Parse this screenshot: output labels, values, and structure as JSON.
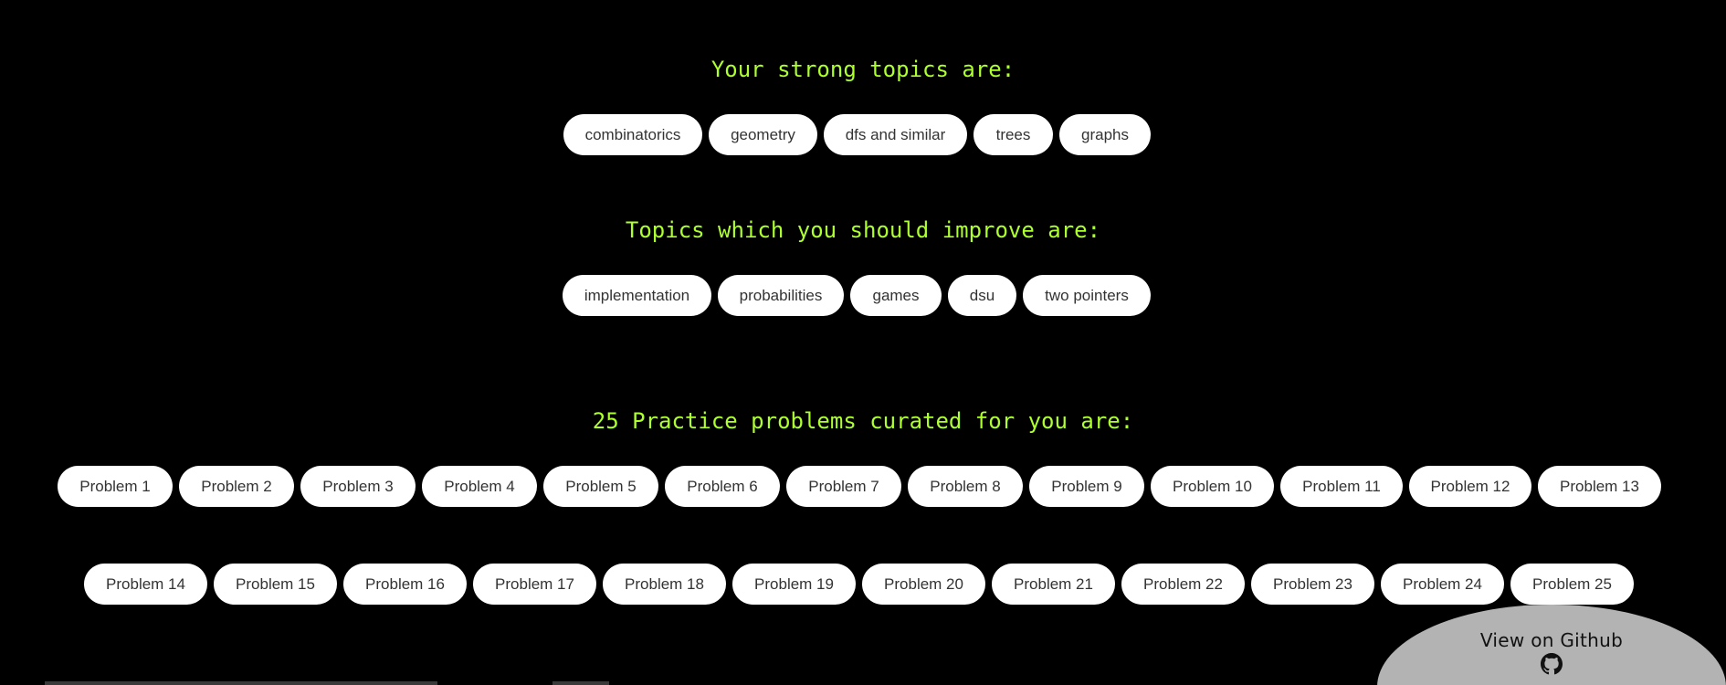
{
  "strong": {
    "heading": "Your strong topics are:",
    "topics": [
      "combinatorics",
      "geometry",
      "dfs and similar",
      "trees",
      "graphs"
    ]
  },
  "improve": {
    "heading": "Topics which you should improve are:",
    "topics": [
      "implementation",
      "probabilities",
      "games",
      "dsu",
      "two pointers"
    ]
  },
  "problems": {
    "heading": "25 Practice problems curated for you are:",
    "row1": [
      "Problem 1",
      "Problem 2",
      "Problem 3",
      "Problem 4",
      "Problem 5",
      "Problem 6",
      "Problem 7",
      "Problem 8",
      "Problem 9",
      "Problem 10",
      "Problem 11",
      "Problem 12",
      "Problem 13"
    ],
    "row2": [
      "Problem 14",
      "Problem 15",
      "Problem 16",
      "Problem 17",
      "Problem 18",
      "Problem 19",
      "Problem 20",
      "Problem 21",
      "Problem 22",
      "Problem 23",
      "Problem 24",
      "Problem 25"
    ]
  },
  "github": {
    "label": "View on Github",
    "icon": "github-icon"
  },
  "colors": {
    "background": "#000000",
    "heading": "#adff2f",
    "pill_bg": "#ffffff",
    "pill_text": "#333333",
    "badge_bg": "#b3b3b3"
  }
}
